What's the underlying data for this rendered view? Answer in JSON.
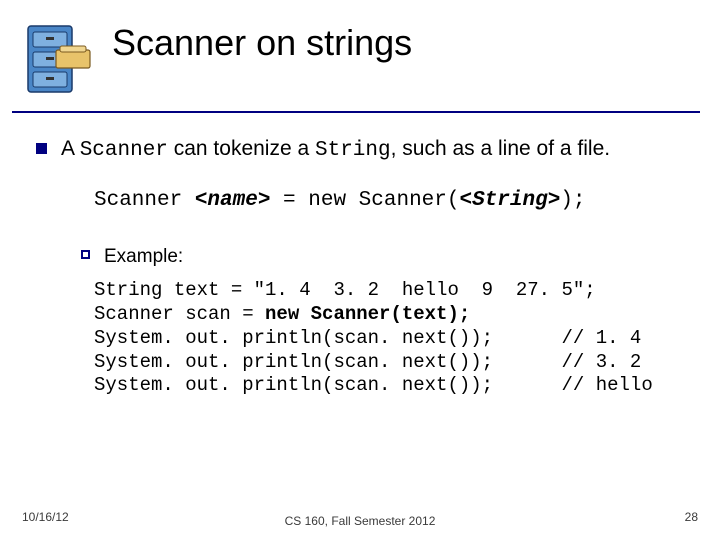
{
  "title": "Scanner on strings",
  "bullet1": {
    "pre": "A ",
    "code1": "Scanner",
    "mid": " can tokenize a ",
    "code2": "String",
    "post": ", such as a line of a file."
  },
  "syntax": {
    "lead": "Scanner ",
    "name": "<name>",
    "mid": " = new Scanner(",
    "str": "<String>",
    "tail": ");"
  },
  "exampleLabel": "Example:",
  "code": {
    "l1a": "String text = \"1. 4  3. 2  hello  9  27. 5\";",
    "l2a": "Scanner scan = ",
    "l2b": "new Scanner(text);",
    "l3": "System. out. println(scan. next());",
    "c3": "// 1. 4",
    "l4": "System. out. println(scan. next());",
    "c4": "// 3. 2",
    "l5": "System. out. println(scan. next());",
    "c5": "// hello"
  },
  "footer": {
    "date": "10/16/12",
    "center": "CS 160, Fall Semester 2012",
    "page": "28"
  }
}
